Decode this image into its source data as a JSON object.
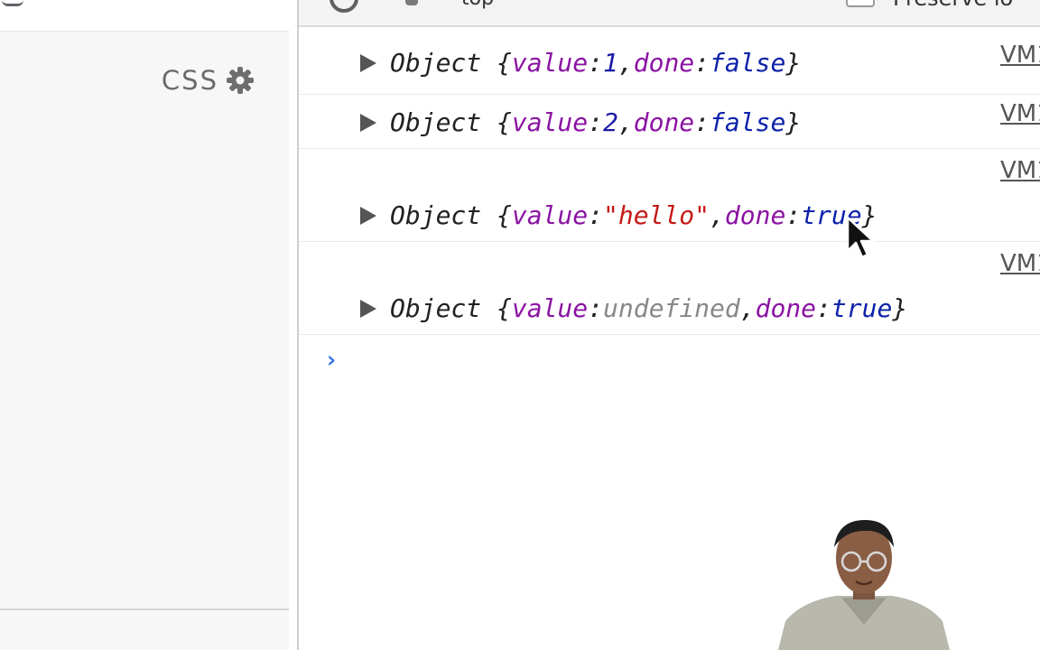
{
  "left_panel": {
    "css_label": "CSS",
    "gear_icon": "gear-icon"
  },
  "toolbar": {
    "context_label": "top",
    "preserve_log_label": "Preserve lo"
  },
  "console": {
    "rows": [
      {
        "source": "VM1",
        "prefix": "Object {",
        "value_key": "value",
        "value": "1",
        "done_key": "done",
        "done": "false",
        "suffix": "}"
      },
      {
        "source": "VM1",
        "prefix": "Object {",
        "value_key": "value",
        "value": "2",
        "done_key": "done",
        "done": "false",
        "suffix": "}"
      },
      {
        "source": "VM1",
        "prefix": "Object {",
        "value_key": "value",
        "value": "\"hello\"",
        "done_key": "done",
        "done": "true",
        "suffix": "}"
      },
      {
        "source": "VM1",
        "prefix": "Object {",
        "value_key": "value",
        "value": "undefined",
        "done_key": "done",
        "done": "true",
        "suffix": "}"
      }
    ],
    "prompt": "›"
  },
  "colors": {
    "key": "#8b13a3",
    "number": "#1a1aa6",
    "boolean": "#0d22aa",
    "string": "#c41a16",
    "undefined": "#888888",
    "prompt": "#2f6ee0"
  }
}
